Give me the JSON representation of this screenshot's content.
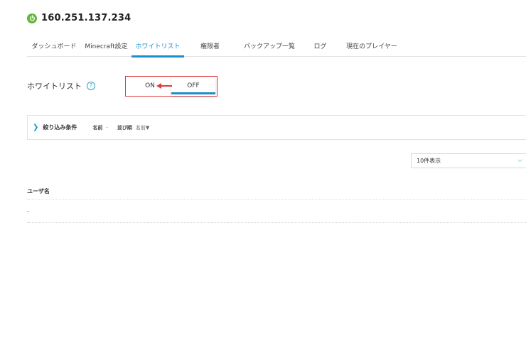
{
  "server": {
    "title": "160.251.137.234"
  },
  "tabs": [
    {
      "label": "ダッシュボード",
      "active": false
    },
    {
      "label": "Minecraft設定",
      "active": false
    },
    {
      "label": "ホワイトリスト",
      "active": true
    },
    {
      "label": "権限者",
      "active": false
    },
    {
      "label": "バックアップ一覧",
      "active": false
    },
    {
      "label": "ログ",
      "active": false
    },
    {
      "label": "現在のプレイヤー",
      "active": false
    }
  ],
  "whitelist": {
    "label": "ホワイトリスト",
    "help_icon": "?",
    "on_label": "ON",
    "off_label": "OFF",
    "selected": "OFF"
  },
  "filter": {
    "title": "絞り込み条件",
    "name_key": "名前",
    "name_value": "-",
    "sort_key": "並び順",
    "sort_value": "名前▼"
  },
  "perpage": {
    "value": "10件表示"
  },
  "table": {
    "columns": [
      "ユーザ名"
    ],
    "rows": [
      [
        "-"
      ]
    ]
  },
  "colors": {
    "accent": "#1a8fc9",
    "highlight": "#e0393e",
    "power": "#62b83a"
  }
}
